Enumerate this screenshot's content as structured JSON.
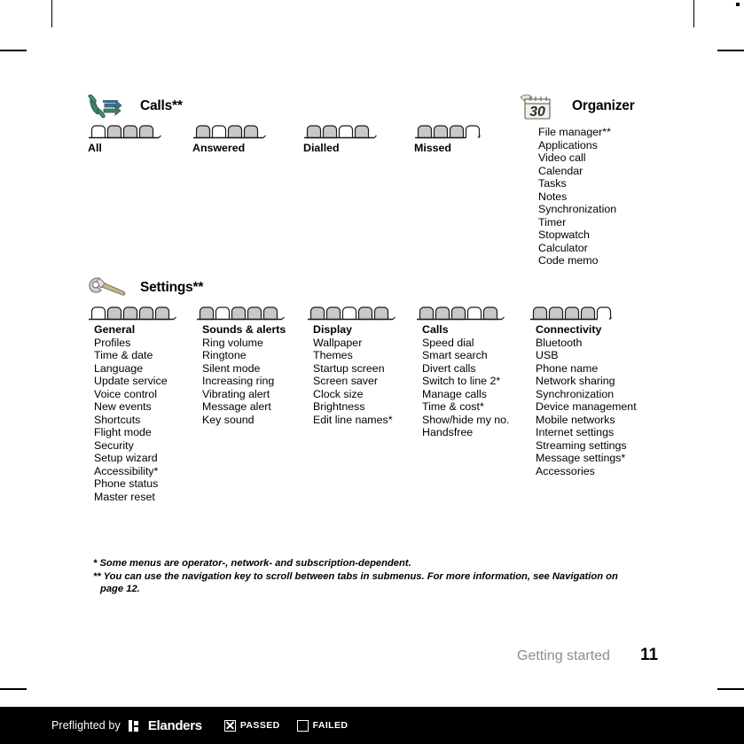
{
  "document": {
    "chapter_footer": "Getting started",
    "page_number": "11"
  },
  "sections": {
    "calls": {
      "title": "Calls**",
      "icon": "phone-calls-icon",
      "tab_groups": [
        {
          "label": "All",
          "tab_count": 4,
          "selected_index": 0
        },
        {
          "label": "Answered",
          "tab_count": 4,
          "selected_index": 1
        },
        {
          "label": "Dialled",
          "tab_count": 4,
          "selected_index": 2
        },
        {
          "label": "Missed",
          "tab_count": 4,
          "selected_index": 3
        }
      ]
    },
    "organizer": {
      "title": "Organizer",
      "icon": "calendar-organizer-icon",
      "items": [
        "File manager**",
        "Applications",
        "Video call",
        "Calendar",
        "Tasks",
        "Notes",
        "Synchronization",
        "Timer",
        "Stopwatch",
        "Calculator",
        "Code memo"
      ]
    },
    "settings": {
      "title": "Settings**",
      "icon": "wrench-settings-icon",
      "columns": [
        {
          "tab_count": 5,
          "selected_index": 0,
          "heading": "General",
          "items": [
            "Profiles",
            "Time & date",
            "Language",
            "Update service",
            "Voice control",
            "New events",
            "Shortcuts",
            "Flight mode",
            "Security",
            "Setup wizard",
            "Accessibility*",
            "Phone status",
            "Master reset"
          ]
        },
        {
          "tab_count": 5,
          "selected_index": 1,
          "heading": "Sounds & alerts",
          "items": [
            "Ring volume",
            "Ringtone",
            "Silent mode",
            "Increasing ring",
            "Vibrating alert",
            "Message alert",
            "Key sound"
          ]
        },
        {
          "tab_count": 5,
          "selected_index": 2,
          "heading": "Display",
          "items": [
            "Wallpaper",
            "Themes",
            "Startup screen",
            "Screen saver",
            "Clock size",
            "Brightness",
            "Edit line names*"
          ]
        },
        {
          "tab_count": 5,
          "selected_index": 3,
          "heading": "Calls",
          "items": [
            "Speed dial",
            "Smart search",
            "Divert calls",
            "Switch to line 2*",
            "Manage calls",
            "Time & cost*",
            "Show/hide my no.",
            "Handsfree"
          ]
        },
        {
          "tab_count": 5,
          "selected_index": 4,
          "heading": "Connectivity",
          "items": [
            "Bluetooth",
            "USB",
            "Phone name",
            "Network sharing",
            "Synchronization",
            "Device management",
            "Mobile networks",
            "Internet settings",
            "Streaming settings",
            "Message settings*",
            "Accessories"
          ]
        }
      ]
    }
  },
  "footnotes": {
    "line1": "* Some menus are operator-, network- and subscription-dependent.",
    "line2": "** You can use the navigation key to scroll between tabs in submenus. For more information, see Navigation on",
    "line3": "page 12."
  },
  "preflight": {
    "prefix": "Preflighted by",
    "brand": "Elanders",
    "passed_label": "PASSED",
    "failed_label": "FAILED",
    "passed_checked": true,
    "failed_checked": false
  },
  "colors": {
    "tab_fill": "#c8c8c8",
    "tab_outline": "#000000",
    "footer_chapter": "#8d8d8d",
    "preflight_bg": "#000000"
  }
}
